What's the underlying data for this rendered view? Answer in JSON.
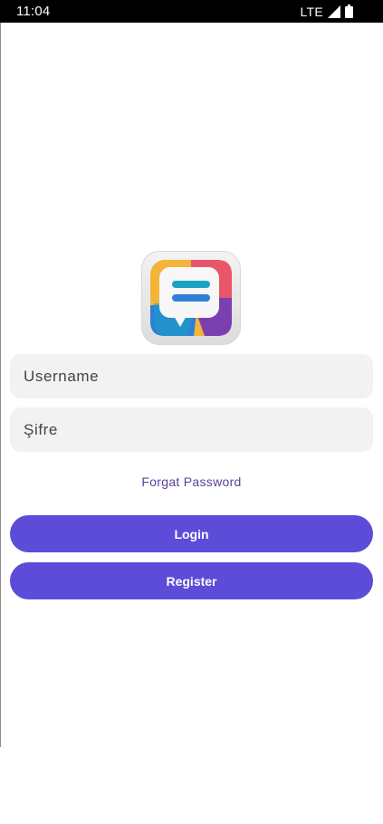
{
  "status_bar": {
    "time": "11:04",
    "network": "LTE",
    "icons": [
      "signal-icon",
      "battery-icon"
    ]
  },
  "logo": {
    "icon": "chat-bubble-logo-icon",
    "colors": [
      "#f2b53a",
      "#e9566a",
      "#7b3fb0",
      "#2f7fd6",
      "#1aa2c4"
    ]
  },
  "form": {
    "username_placeholder": "Username",
    "password_placeholder": "Şifre",
    "forgot_password": "Forgat Password",
    "login_label": "Login",
    "register_label": "Register"
  },
  "colors": {
    "accent": "#5c4cd8",
    "link": "#5b3f9e",
    "field_bg": "#f2f2f2"
  }
}
